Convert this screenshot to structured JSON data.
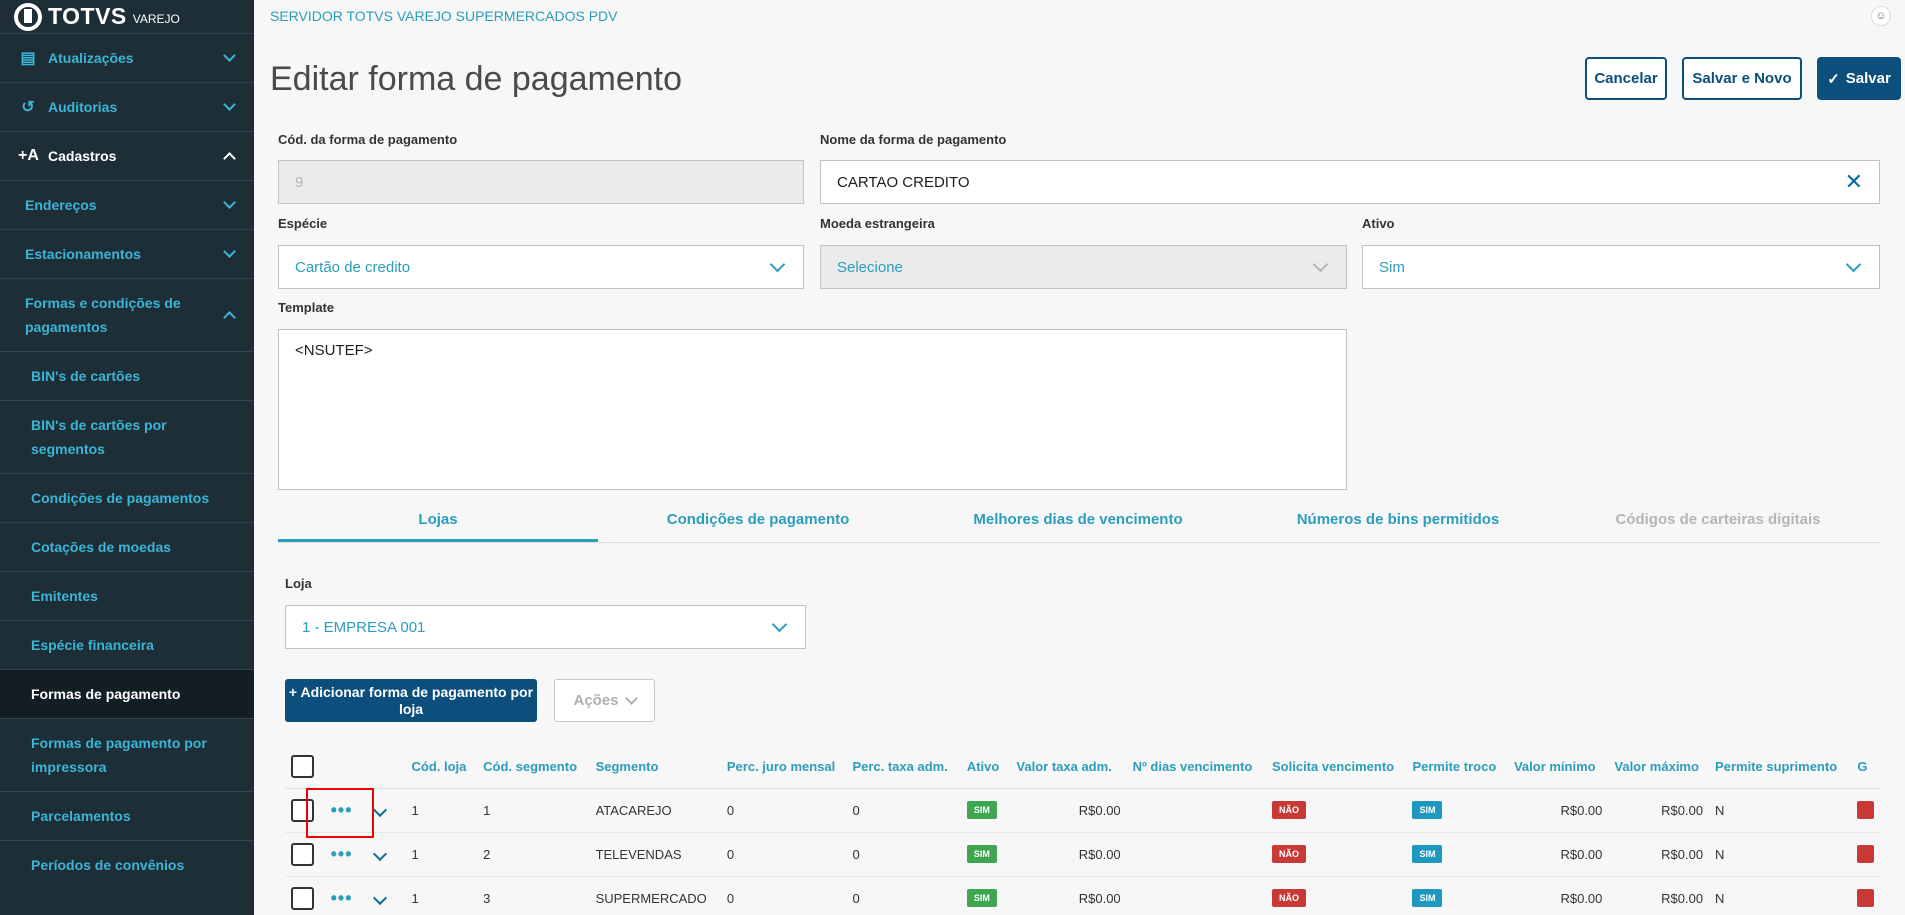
{
  "brand": {
    "name": "TOTVS",
    "sub": "VAREJO"
  },
  "sidebar": {
    "items": [
      {
        "label": "Atualizações",
        "icon": "server-icon"
      },
      {
        "label": "Auditorias",
        "icon": "history-icon"
      },
      {
        "label": "Cadastros",
        "icon": "add-user-icon"
      }
    ],
    "sub_items": [
      {
        "label": "Endereços"
      },
      {
        "label": "Estacionamentos"
      },
      {
        "label": "Formas e condições de pagamentos"
      }
    ],
    "leaf_items": [
      {
        "label": "BIN's de cartões"
      },
      {
        "label": "BIN's de cartões por segmentos"
      },
      {
        "label": "Condições de pagamentos"
      },
      {
        "label": "Cotações de moedas"
      },
      {
        "label": "Emitentes"
      },
      {
        "label": "Espécie financeira"
      },
      {
        "label": "Formas de pagamento"
      },
      {
        "label": "Formas de pagamento por impressora"
      },
      {
        "label": "Parcelamentos"
      },
      {
        "label": "Períodos de convênios"
      }
    ]
  },
  "header": {
    "server": "SERVIDOR TOTVS VAREJO SUPERMERCADOS PDV",
    "title": "Editar forma de pagamento",
    "cancel_label": "Cancelar",
    "save_new_label": "Salvar e Novo",
    "save_label": "Salvar"
  },
  "form": {
    "cod_label": "Cód. da forma de pagamento",
    "cod_value": "9",
    "nome_label": "Nome da forma de pagamento",
    "nome_value": "CARTAO CREDITO",
    "especie_label": "Espécie",
    "especie_value": "Cartão de credito",
    "moeda_label": "Moeda estrangeira",
    "moeda_placeholder": "Selecione",
    "ativo_label": "Ativo",
    "ativo_value": "Sim",
    "template_label": "Template",
    "template_value": "<NSUTEF>"
  },
  "tabs": [
    {
      "label": "Lojas"
    },
    {
      "label": "Condições de pagamento"
    },
    {
      "label": "Melhores dias de vencimento"
    },
    {
      "label": "Números de bins permitidos"
    },
    {
      "label": "Códigos de carteiras digitais"
    }
  ],
  "lojas": {
    "loja_label": "Loja",
    "loja_value": "1 - EMPRESA 001",
    "add_label": "+ Adicionar forma de pagamento por loja",
    "acoes_label": "Ações"
  },
  "table": {
    "headers": {
      "cod_loja": "Cód. loja",
      "cod_segmento": "Cód. segmento",
      "segmento": "Segmento",
      "perc_juro": "Perc. juro mensal",
      "perc_taxa": "Perc. taxa adm.",
      "ativo": "Ativo",
      "valor_taxa": "Valor taxa adm.",
      "dias_venc": "Nº dias vencimento",
      "solicita_venc": "Solicita vencimento",
      "permite_troco": "Permite troco",
      "valor_min": "Valor mínimo",
      "valor_max": "Valor máximo",
      "permite_supr": "Permite suprimento",
      "more": "G"
    },
    "rows": [
      {
        "cod_loja": "1",
        "cod_segmento": "1",
        "segmento": "ATACAREJO",
        "perc_juro": "0",
        "perc_taxa": "0",
        "ativo": "SIM",
        "valor_taxa": "R$0.00",
        "dias_venc": "",
        "solicita_venc": "NÃO",
        "permite_troco": "SIM",
        "valor_min": "R$0.00",
        "valor_max": "R$0.00",
        "permite_supr": "N"
      },
      {
        "cod_loja": "1",
        "cod_segmento": "2",
        "segmento": "TELEVENDAS",
        "perc_juro": "0",
        "perc_taxa": "0",
        "ativo": "SIM",
        "valor_taxa": "R$0.00",
        "dias_venc": "",
        "solicita_venc": "NÃO",
        "permite_troco": "SIM",
        "valor_min": "R$0.00",
        "valor_max": "R$0.00",
        "permite_supr": "N"
      },
      {
        "cod_loja": "1",
        "cod_segmento": "3",
        "segmento": "SUPERMERCADO",
        "perc_juro": "0",
        "perc_taxa": "0",
        "ativo": "SIM",
        "valor_taxa": "R$0.00",
        "dias_venc": "",
        "solicita_venc": "NÃO",
        "permite_troco": "SIM",
        "valor_min": "R$0.00",
        "valor_max": "R$0.00",
        "permite_supr": "N"
      }
    ]
  },
  "colors": {
    "primary": "#0c4f7d",
    "accent": "#2b9dbd",
    "sidebar_bg": "#1e2e37",
    "green": "#3fa54f",
    "red": "#c93936",
    "blue": "#1e98bf"
  }
}
